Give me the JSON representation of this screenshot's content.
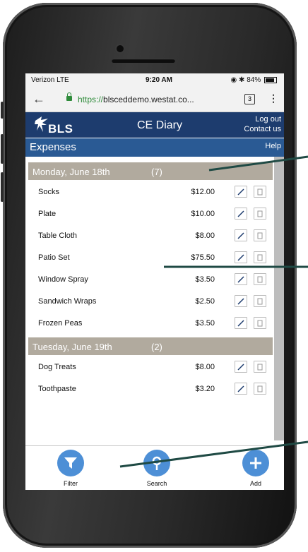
{
  "status_bar": {
    "carrier": "Verizon  LTE",
    "time": "9:20 AM",
    "battery": "84%",
    "battery_level": 0.84
  },
  "browser": {
    "url_scheme": "https://",
    "url_host": "blsceddemo.westat.co...",
    "tab_count": "3"
  },
  "app": {
    "logo_text": "BLS",
    "title": "CE Diary",
    "logout_label": "Log out",
    "contact_label": "Contact us"
  },
  "section": {
    "title": "Expenses",
    "help_label": "Help"
  },
  "days": [
    {
      "date": "Monday, June 18th",
      "count": "(7)",
      "items": [
        {
          "name": "Socks",
          "price": "$12.00"
        },
        {
          "name": "Plate",
          "price": "$10.00"
        },
        {
          "name": "Table Cloth",
          "price": "$8.00"
        },
        {
          "name": "Patio Set",
          "price": "$75.50"
        },
        {
          "name": "Window Spray",
          "price": "$3.50"
        },
        {
          "name": "Sandwich Wraps",
          "price": "$2.50"
        },
        {
          "name": "Frozen Peas",
          "price": "$3.50"
        }
      ]
    },
    {
      "date": "Tuesday, June 19th",
      "count": "(2)",
      "items": [
        {
          "name": "Dog Treats",
          "price": "$8.00"
        },
        {
          "name": "Toothpaste",
          "price": "$3.20"
        }
      ]
    }
  ],
  "bottom_nav": {
    "filter_label": "Filter",
    "search_label": "Search",
    "add_label": "Add"
  },
  "icons": {
    "edit": "pencil-icon",
    "delete": "trash-icon",
    "filter": "funnel-icon",
    "search": "magnifier-icon",
    "add": "plus-icon"
  },
  "colors": {
    "header": "#1d3c6e",
    "section_bar": "#2a5a94",
    "day_header": "#b1aa9e",
    "nav_button": "#4d8fd6",
    "callout": "#1f4a44"
  }
}
